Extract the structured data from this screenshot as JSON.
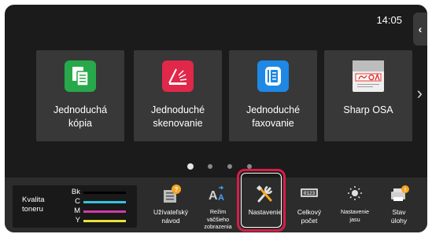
{
  "status": {
    "time": "14:05"
  },
  "nav": {
    "collapse_glyph": "‹",
    "next_glyph": "›"
  },
  "tiles": [
    {
      "label_line1": "Jednoduchá",
      "label_line2": "kópia",
      "icon": "copy-icon",
      "color": "#27a84a"
    },
    {
      "label_line1": "Jednoduché",
      "label_line2": "skenovanie",
      "icon": "scan-icon",
      "color": "#e0284a"
    },
    {
      "label_line1": "Jednoduché",
      "label_line2": "faxovanie",
      "icon": "fax-icon",
      "color": "#1e88e5"
    },
    {
      "label_line1": "Sharp OSA",
      "label_line2": "",
      "icon": "sharp-osa-icon",
      "color": "#e53935"
    }
  ],
  "pager": {
    "pages": 4,
    "current": 1
  },
  "toner": {
    "title_line1": "Kvalita",
    "title_line2": "toneru",
    "rows": [
      {
        "label": "Bk",
        "color": "#000000"
      },
      {
        "label": "C",
        "color": "#33c3e0"
      },
      {
        "label": "M",
        "color": "#d23aa8"
      },
      {
        "label": "Y",
        "color": "#e8e23a"
      }
    ]
  },
  "bottom_items": [
    {
      "line1": "Užívateľský",
      "line2": "návod",
      "line3": "",
      "icon": "user-guide-icon",
      "small": false
    },
    {
      "line1": "Režim",
      "line2": "väčšieho",
      "line3": "zobrazenia",
      "icon": "large-text-icon",
      "small": true
    },
    {
      "line1": "Nastavenie",
      "line2": "",
      "line3": "",
      "icon": "settings-tools-icon",
      "small": false
    },
    {
      "line1": "Celkový",
      "line2": "počet",
      "line3": "",
      "icon": "counter-icon",
      "small": false
    },
    {
      "line1": "Nastavenie",
      "line2": "jasu",
      "line3": "",
      "icon": "brightness-icon",
      "small": true
    },
    {
      "line1": "Stav",
      "line2": "úlohy",
      "line3": "",
      "icon": "job-status-icon",
      "small": false
    }
  ],
  "colors": {
    "accent_highlight": "#d41e4a",
    "screen_bg": "#1b1b1b",
    "tile_bg": "#383838"
  }
}
